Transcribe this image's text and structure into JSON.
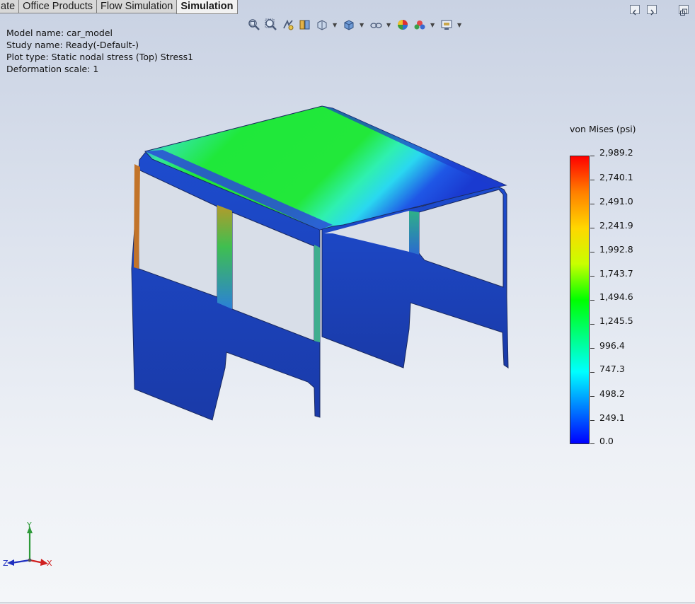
{
  "tabs": [
    {
      "label": "ate",
      "active": false
    },
    {
      "label": "Office Products",
      "active": false
    },
    {
      "label": "Flow Simulation",
      "active": false
    },
    {
      "label": "Simulation",
      "active": true
    }
  ],
  "toolbar": {
    "icons": [
      "zoom-to-fit-icon",
      "zoom-to-area-icon",
      "previous-view-icon",
      "section-view-icon",
      "view-orientation-icon",
      "display-style-icon",
      "hide-show-items-icon",
      "edit-appearance-icon",
      "apply-scene-icon",
      "view-settings-icon"
    ]
  },
  "info": {
    "model_name": "Model name: car_model",
    "study_name": "Study name: Ready(-Default-)",
    "plot_type": "Plot type: Static nodal stress (Top) Stress1",
    "deformation": "Deformation scale: 1"
  },
  "legend": {
    "title": "von Mises (psi)",
    "labels": [
      "2,989.2",
      "2,740.1",
      "2,491.0",
      "2,241.9",
      "1,992.8",
      "1,743.7",
      "1,494.6",
      "1,245.5",
      "996.4",
      "747.3",
      "498.2",
      "249.1",
      "0.0"
    ],
    "colors": {
      "max": "#ff0000",
      "mid": "#00ff00",
      "min": "#0000ff"
    }
  },
  "triad": {
    "x": "X",
    "y": "Y",
    "z": "Z"
  }
}
